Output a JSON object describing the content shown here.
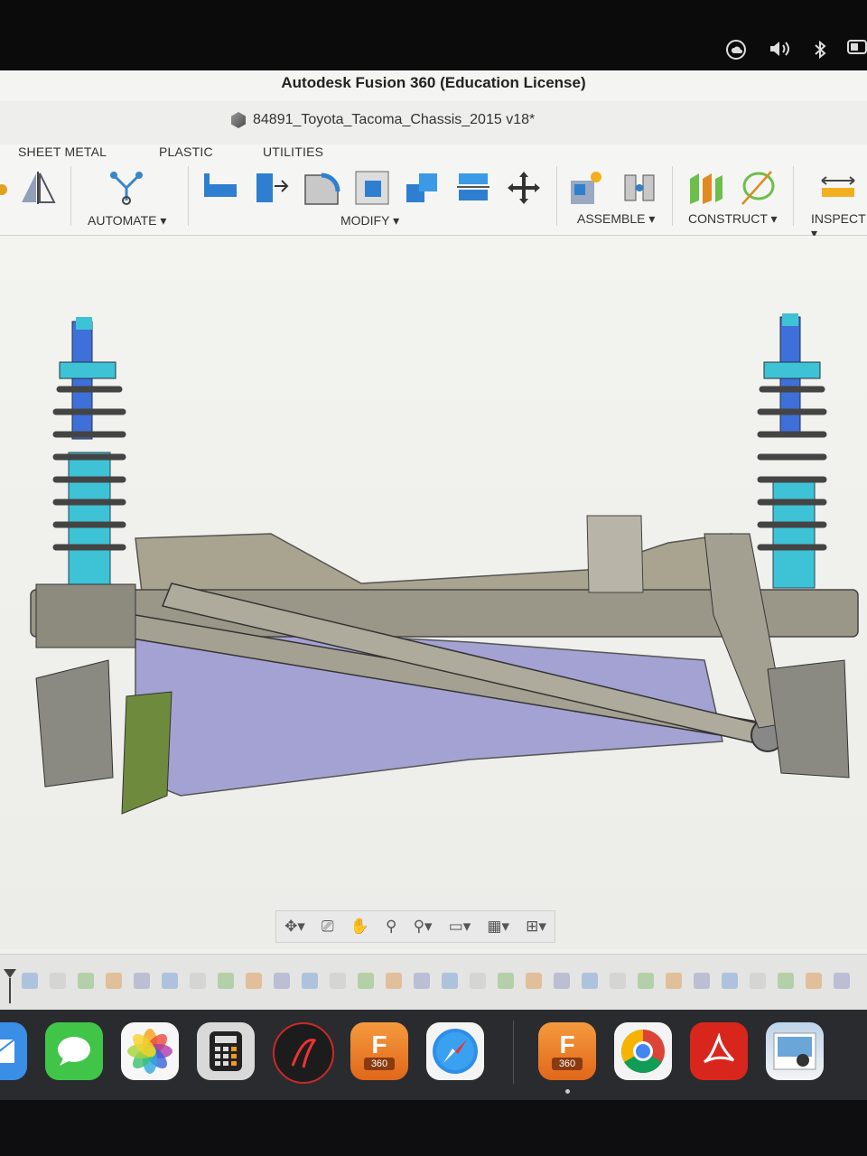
{
  "window": {
    "app_title": "Autodesk Fusion 360 (Education License)",
    "document_title": "84891_Toyota_Tacoma_Chassis_2015 v18*"
  },
  "toolbar": {
    "tabs": [
      "SHEET METAL",
      "PLASTIC",
      "UTILITIES"
    ],
    "groups": {
      "automate": "AUTOMATE",
      "modify": "MODIFY",
      "assemble": "ASSEMBLE",
      "construct": "CONSTRUCT",
      "inspect": "INSPECT"
    },
    "dropdown_glyph": "▾"
  },
  "nav_bar": {
    "tools": [
      "orbit-icon",
      "look-at-icon",
      "pan-icon",
      "zoom-icon",
      "zoom-window-icon",
      "display-settings-icon",
      "grid-settings-icon",
      "viewports-icon"
    ]
  },
  "dock": {
    "apps": [
      "Mail",
      "Messages",
      "Photos",
      "Calculator",
      "Launcher",
      "Fusion 360",
      "Safari",
      "Fusion 360",
      "Google Chrome",
      "Adobe Acrobat",
      "Preview"
    ],
    "fusion_badge_letter": "F",
    "fusion_badge_number": "360"
  },
  "colors": {
    "coilover_teal": "#3ec3d6",
    "shaft_blue": "#3f6fd8",
    "frame_tan": "#a9a48f",
    "crossmember_lavender": "#a4a2d2",
    "fusion_orange": "#f27a1f"
  }
}
